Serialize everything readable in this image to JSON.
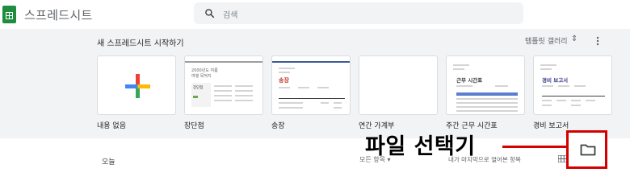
{
  "app": {
    "title": "스프레드시트",
    "logo_icon": "sheets-logo-icon"
  },
  "search": {
    "placeholder": "검색"
  },
  "templates": {
    "section_title": "새 스프레드시트 시작하기",
    "gallery_label": "템플릿 갤러리",
    "gallery_toggle": "⇕",
    "items": [
      {
        "label": "내용 없음"
      },
      {
        "label": "장단점"
      },
      {
        "label": "송장"
      },
      {
        "label": "연간 가계부"
      },
      {
        "label": "주간 근무 시간표"
      },
      {
        "label": "경비 보고서"
      }
    ],
    "thumb_text": {
      "pros_title": "2000년도 여름",
      "pros_sub": "여행 목적지",
      "pros_a": "장단점",
      "pros_b": "",
      "invoice_title": "송장",
      "timesheet_title": "근무 시간표",
      "expense_title": "경비 보고서"
    }
  },
  "files": {
    "today_label": "오늘",
    "owner_filter": "모든 항목 ▾",
    "sort_label": "내가 마지막으로 열어본 항목"
  },
  "annotation": {
    "text": "파일 선택기",
    "accent_color": "#d40000"
  }
}
